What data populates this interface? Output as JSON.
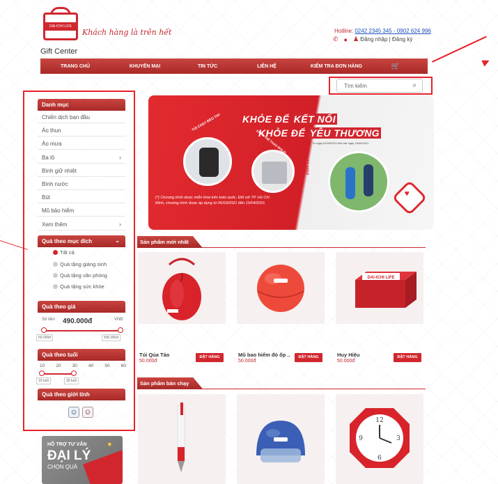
{
  "header": {
    "logo_badge": "DAI-ICHI LIFE",
    "logo_caption": "Gift Center",
    "slogan": "Khách hàng là trên hết",
    "hotline_label": "Hotline: ",
    "hotline_numbers": "0242 2345 345 - 0902 624 996",
    "account_links": "Đăng nhập | Đăng ký"
  },
  "nav": {
    "items": [
      "TRANG CHỦ",
      "KHUYẾN MẠI",
      "TIN TỨC",
      "LIÊN HỆ",
      "KIỂM TRA ĐƠN HÀNG"
    ],
    "cart_icon": "cart-icon"
  },
  "search": {
    "placeholder": "Tìm kiếm"
  },
  "sidebar": {
    "category_title": "Danh mục",
    "categories": [
      "Chiến dịch ban đầu",
      "Áo thun",
      "Áo mưa",
      "Ba lô",
      "Bình giữ nhiệt",
      "Bình nước",
      "Bút",
      "Mũ bảo hiểm",
      "Xem thêm"
    ],
    "purpose_title": "Quà theo mục đích",
    "purposes": [
      "Tất cả",
      "Quà tặng giáng sinh",
      "Quà tặng văn phòng",
      "Quà tặng sức khỏe"
    ],
    "price_title": "Quà theo giá",
    "price_label": "Số tiền",
    "price_value": "490.000đ",
    "price_unit": "VNĐ",
    "price_min": "50.000đ",
    "price_max": "500.000đ",
    "age_title": "Quà theo tuổi",
    "age_ticks": [
      "10",
      "20",
      "30",
      "40",
      "50",
      "60"
    ],
    "age_min": "10 tuổi",
    "age_max": "30 tuổi",
    "gender_title": "Quà theo giới tính"
  },
  "support": {
    "line1": "HỖ TRỢ TƯ VẤN",
    "line2": "ĐẠI LÝ",
    "line3": "CHỌN QUÀ"
  },
  "banner": {
    "line1a": "KHỎE ĐỂ ",
    "line1b": "KẾT NỐI",
    "line2a": "KHỎE ĐỂ ",
    "line2b": "YÊU THƯƠNG",
    "dates": "Từ ngày 01/03/2021 đến hết ngày 15/04/2021",
    "ribbon1": "TÚI CHẠY ĐEO TAY",
    "ribbon2": "KHĂN THỂ THAO MOLIS",
    "money": "12.000đ",
    "note": "(*) Chương trình được miễn khai trên toàn quốc. Đối với TP. Hồ Chí Minh, chương trình được áp dụng từ 05/03/2021 đến 15/04/2021."
  },
  "sections": {
    "new_title": "Sản phẩm mới nhất",
    "best_title": "Sản phẩm bán chạy"
  },
  "products": [
    {
      "name": "Túi Qủa Táo",
      "price": "50.000đ",
      "button": "ĐẶT HÀNG"
    },
    {
      "name": "Mũ bao hiểm đỏ ốp ...",
      "price": "50.000đ",
      "button": "ĐẶT HÀNG"
    },
    {
      "name": "Huy Hiệu",
      "price": "50.000đ",
      "button": "ĐẶT HÀNG"
    }
  ],
  "colors": {
    "brand_red": "#d1262e",
    "annotation_red": "#e8212a"
  }
}
